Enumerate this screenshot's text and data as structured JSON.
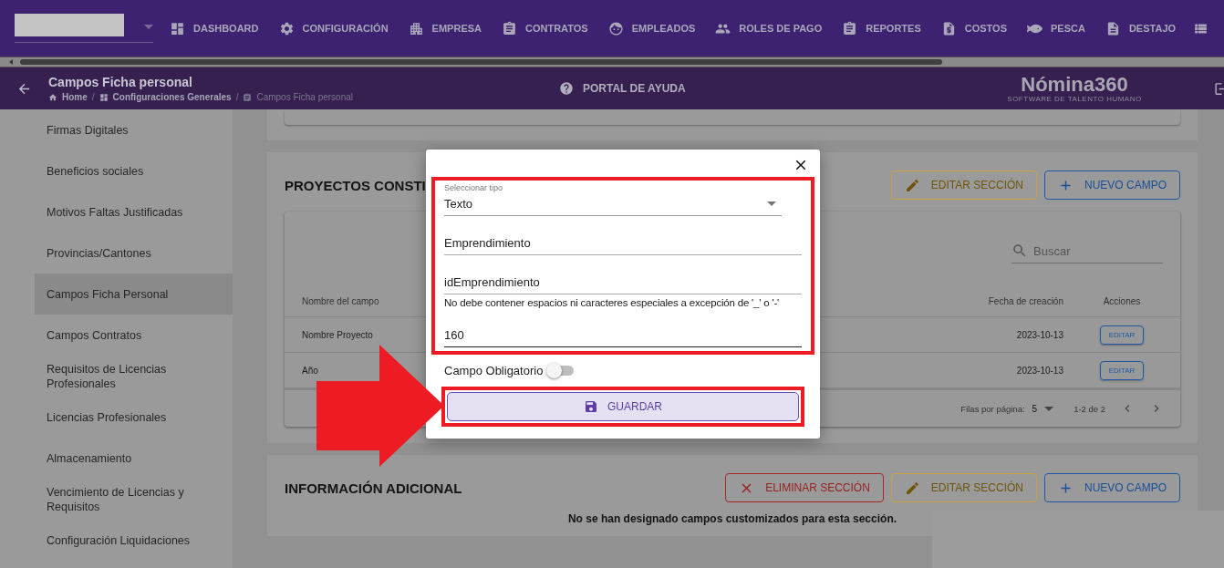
{
  "nav": {
    "items": [
      {
        "label": "DASHBOARD"
      },
      {
        "label": "CONFIGURACIÓN"
      },
      {
        "label": "EMPRESA"
      },
      {
        "label": "CONTRATOS"
      },
      {
        "label": "EMPLEADOS"
      },
      {
        "label": "ROLES DE PAGO"
      },
      {
        "label": "REPORTES"
      },
      {
        "label": "COSTOS"
      },
      {
        "label": "PESCA"
      },
      {
        "label": "DESTAJO"
      }
    ]
  },
  "header": {
    "title": "Campos Ficha personal",
    "breadcrumb": [
      {
        "label": "Home"
      },
      {
        "separator": "/",
        "label": "Configuraciones Generales"
      },
      {
        "separator": "/",
        "label": "Campos Ficha personal"
      }
    ],
    "help_link": "PORTAL DE AYUDA",
    "logo": {
      "name": "Nómina360",
      "tagline": "SOFTWARE DE TALENTO HUMANO"
    }
  },
  "sidebar": {
    "items": [
      {
        "label": "Firmas Digitales",
        "selected": false
      },
      {
        "label": "Beneficios sociales",
        "selected": false
      },
      {
        "label": "Motivos Faltas Justificadas",
        "selected": false
      },
      {
        "label": "Provincias/Cantones",
        "selected": false
      },
      {
        "label": "Campos Ficha Personal",
        "selected": true
      },
      {
        "label": "Campos Contratos",
        "selected": false
      },
      {
        "label": "Requisitos de Licencias Profesionales",
        "selected": false
      },
      {
        "label": "Licencias Profesionales",
        "selected": false
      },
      {
        "label": "Almacenamiento",
        "selected": false
      },
      {
        "label": "Vencimiento de Licencias y Requisitos",
        "selected": false
      },
      {
        "label": "Configuración Liquidaciones",
        "selected": false
      }
    ]
  },
  "sections": [
    {
      "title": "PROYECTOS CONSTI",
      "buttons": [
        {
          "kind": "edit",
          "label": "EDITAR SECCIÓN"
        },
        {
          "kind": "new",
          "label": "NUEVO CAMPO"
        }
      ],
      "table": {
        "search": {
          "placeholder": "Buscar"
        },
        "columns": [
          "Nombre del campo",
          "Fecha de creación",
          "Acciones"
        ],
        "rows": [
          {
            "name": "Nombre Proyecto",
            "date": "2023-10-13",
            "action": "EDITAR"
          },
          {
            "name": "Año",
            "date": "2023-10-13",
            "action": "EDITAR"
          }
        ],
        "pagination": {
          "label": "Filas por página:",
          "value": "5",
          "range": "1-2 de 2"
        }
      }
    },
    {
      "title": "INFORMACIÓN ADICIONAL",
      "buttons": [
        {
          "kind": "delete",
          "label": "ELIMINAR SECCIÓN"
        },
        {
          "kind": "edit",
          "label": "EDITAR SECCIÓN"
        },
        {
          "kind": "new",
          "label": "NUEVO CAMPO"
        }
      ],
      "empty_message": "No se han designado campos customizados para esta sección."
    }
  ],
  "modal": {
    "select": {
      "label": "Seleccionar tipo",
      "value": "Texto"
    },
    "fields": [
      {
        "value": "Emprendimiento",
        "focused": false
      },
      {
        "value": "idEmprendimiento",
        "focused": false,
        "helper": "No debe contener espacios ni caracteres especiales a excepción de '_' o '-'"
      },
      {
        "value": "160",
        "focused": true
      }
    ],
    "switch": {
      "label": "Campo Obligatorio",
      "on": false
    },
    "button": "GUARDAR"
  }
}
